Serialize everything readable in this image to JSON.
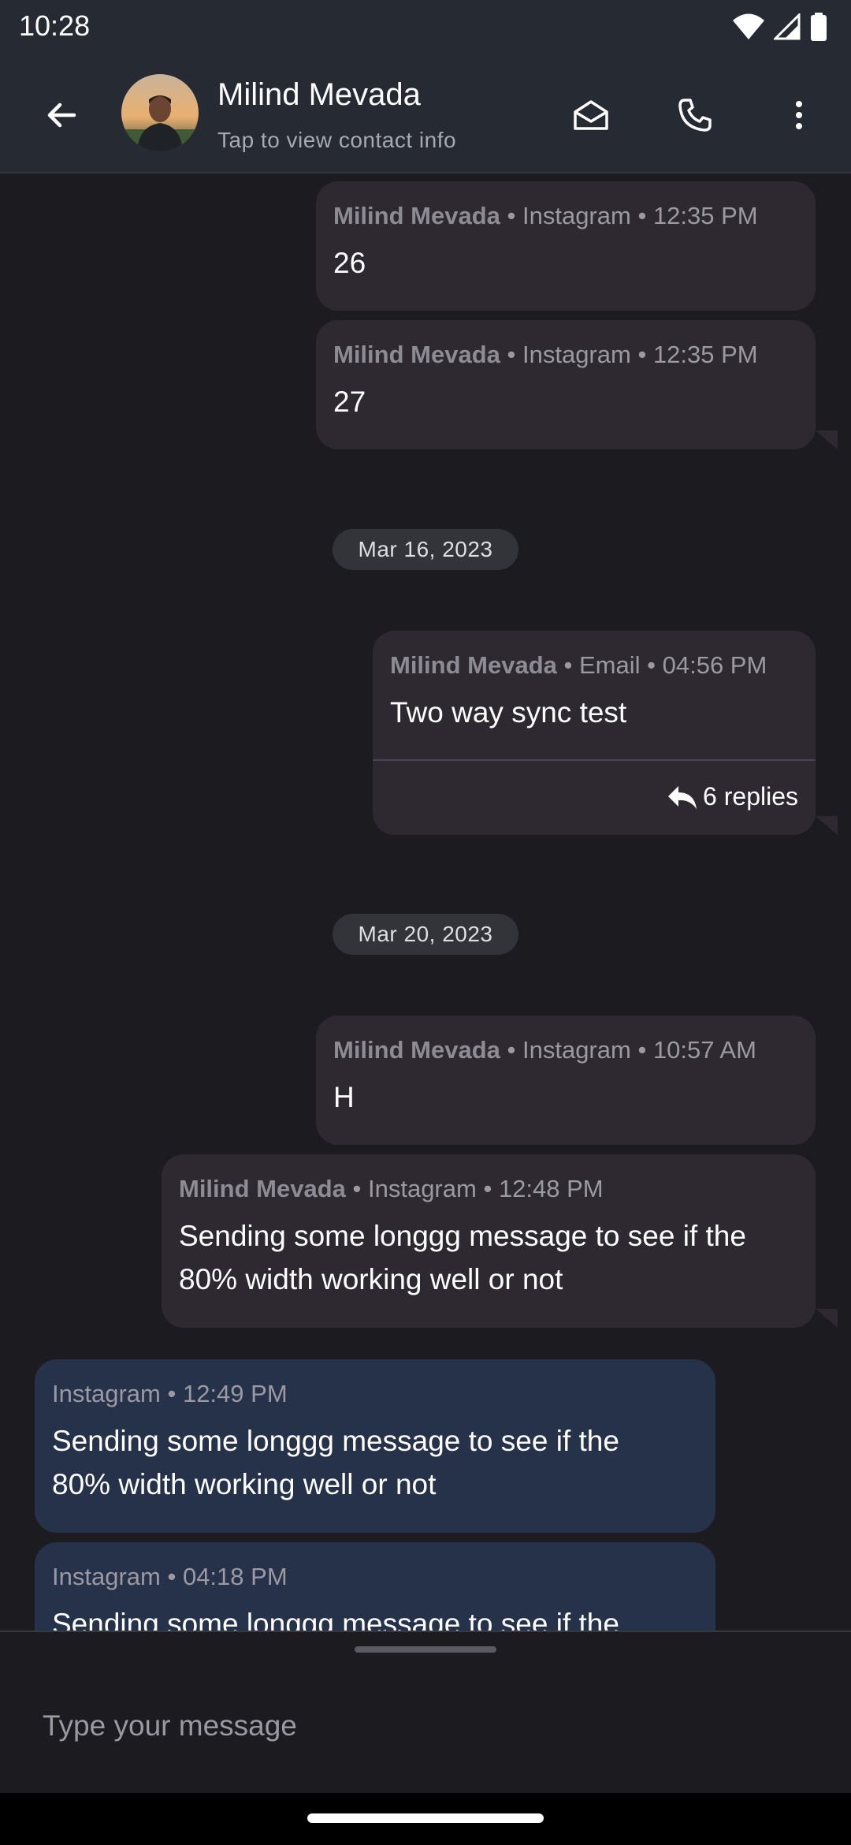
{
  "status_bar": {
    "time": "10:28"
  },
  "header": {
    "contact_name": "Milind Mevada",
    "subtitle": "Tap to view contact info"
  },
  "messages": [
    {
      "sender": "Milind Mevada",
      "channel": "Instagram",
      "time": "12:35 PM",
      "text": "26"
    },
    {
      "sender": "Milind Mevada",
      "channel": "Instagram",
      "time": "12:35 PM",
      "text": "27"
    },
    {
      "sender": "Milind Mevada",
      "channel": "Email",
      "time": "04:56 PM",
      "text": "Two way sync test",
      "replies": "6 replies"
    },
    {
      "sender": "Milind Mevada",
      "channel": "Instagram",
      "time": "10:57 AM",
      "text": "H"
    },
    {
      "sender": "Milind Mevada",
      "channel": "Instagram",
      "time": "12:48 PM",
      "text": "Sending some longgg message to see if the 80% width working well or not"
    },
    {
      "channel": "Instagram",
      "time": "12:49 PM",
      "text": "Sending some longgg message to see if the 80% width working well or not"
    },
    {
      "channel": "Instagram",
      "time": "04:18 PM",
      "text": "Sending some longgg message to see if the"
    }
  ],
  "date_separators": [
    "Mar 16, 2023",
    "Mar 20, 2023"
  ],
  "meta_separator": "•",
  "composer": {
    "placeholder": "Type your message",
    "value": ""
  },
  "colors": {
    "header_bg": "#262a33",
    "background": "#1c1b1f",
    "outgoing_bubble": "#2e2930",
    "incoming_bubble": "#26314a",
    "date_chip": "#33333a"
  }
}
